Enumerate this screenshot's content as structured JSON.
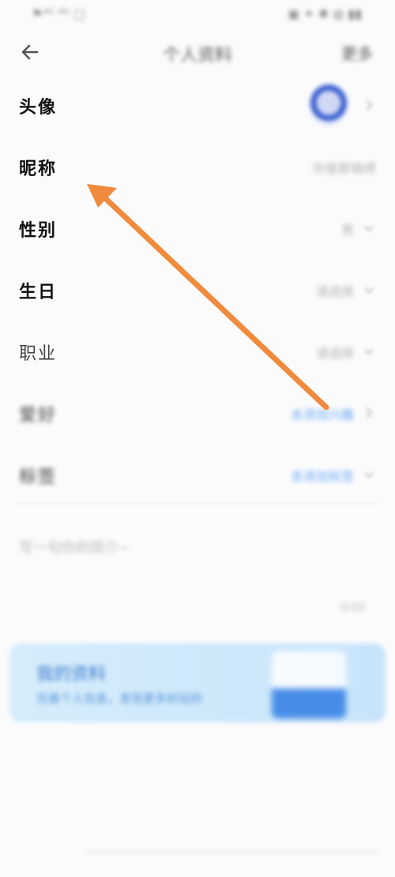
{
  "status_bar": {
    "left": "⚑⁴ᴳ ⁴ᴳ ▢",
    "right": "▣ ✦ ✱ ◍ ▮▮"
  },
  "navbar": {
    "back_icon": "arrow-left-icon",
    "title": "个人资料",
    "more": "更多"
  },
  "rows": [
    {
      "label": "头像",
      "value": ""
    },
    {
      "label": "昵称",
      "value": "你是那锦绣"
    },
    {
      "label": "性别",
      "value": "男"
    },
    {
      "label": "生日",
      "value": "请选择"
    },
    {
      "label": "职业",
      "value": "请选择"
    },
    {
      "label": "爱好",
      "value": "去添加兴趣"
    },
    {
      "label": "标签",
      "value": "去添加标签"
    }
  ],
  "bio": {
    "placeholder": "写一句你的简介~",
    "count": "0/30"
  },
  "banner": {
    "title": "我的资料",
    "subtitle": "完善个人信息，发现更多好玩的"
  },
  "colors": {
    "accent_arrow": "#f08a3c",
    "link": "#3b8cf3",
    "banner_bg": "#d6ecfb"
  }
}
